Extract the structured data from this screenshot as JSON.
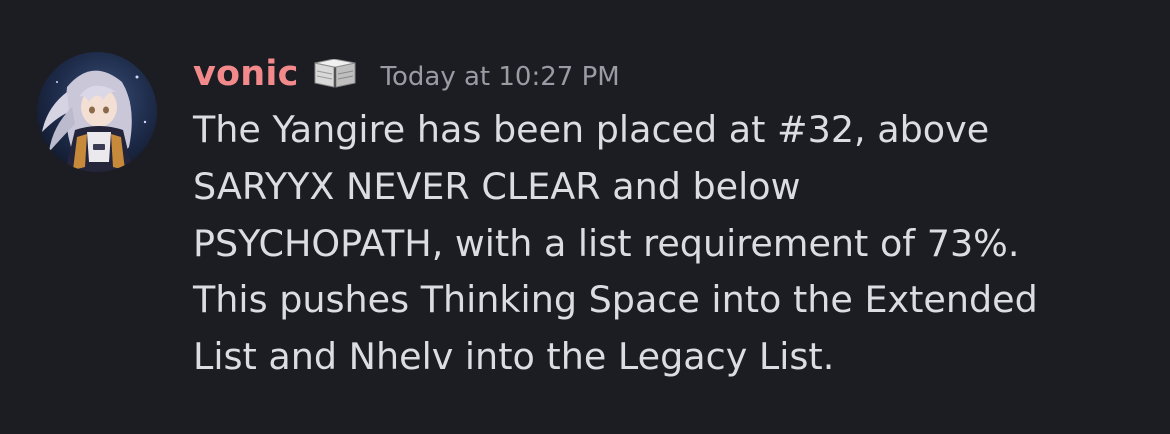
{
  "message": {
    "author": "vonic",
    "author_color": "#f28a8c",
    "badge_icon": "book-icon",
    "timestamp": "Today at 10:27 PM",
    "lines": [
      "The Yangire has been placed at #32, above",
      "SARYYX NEVER CLEAR and below",
      "PSYCHOPATH, with a list requirement of 73%.",
      "This pushes Thinking Space into the Extended",
      "List and Nhelv into the Legacy List."
    ]
  },
  "theme": {
    "background": "#1c1d22",
    "text": "#dcdde3",
    "muted": "#9a9ba5"
  }
}
